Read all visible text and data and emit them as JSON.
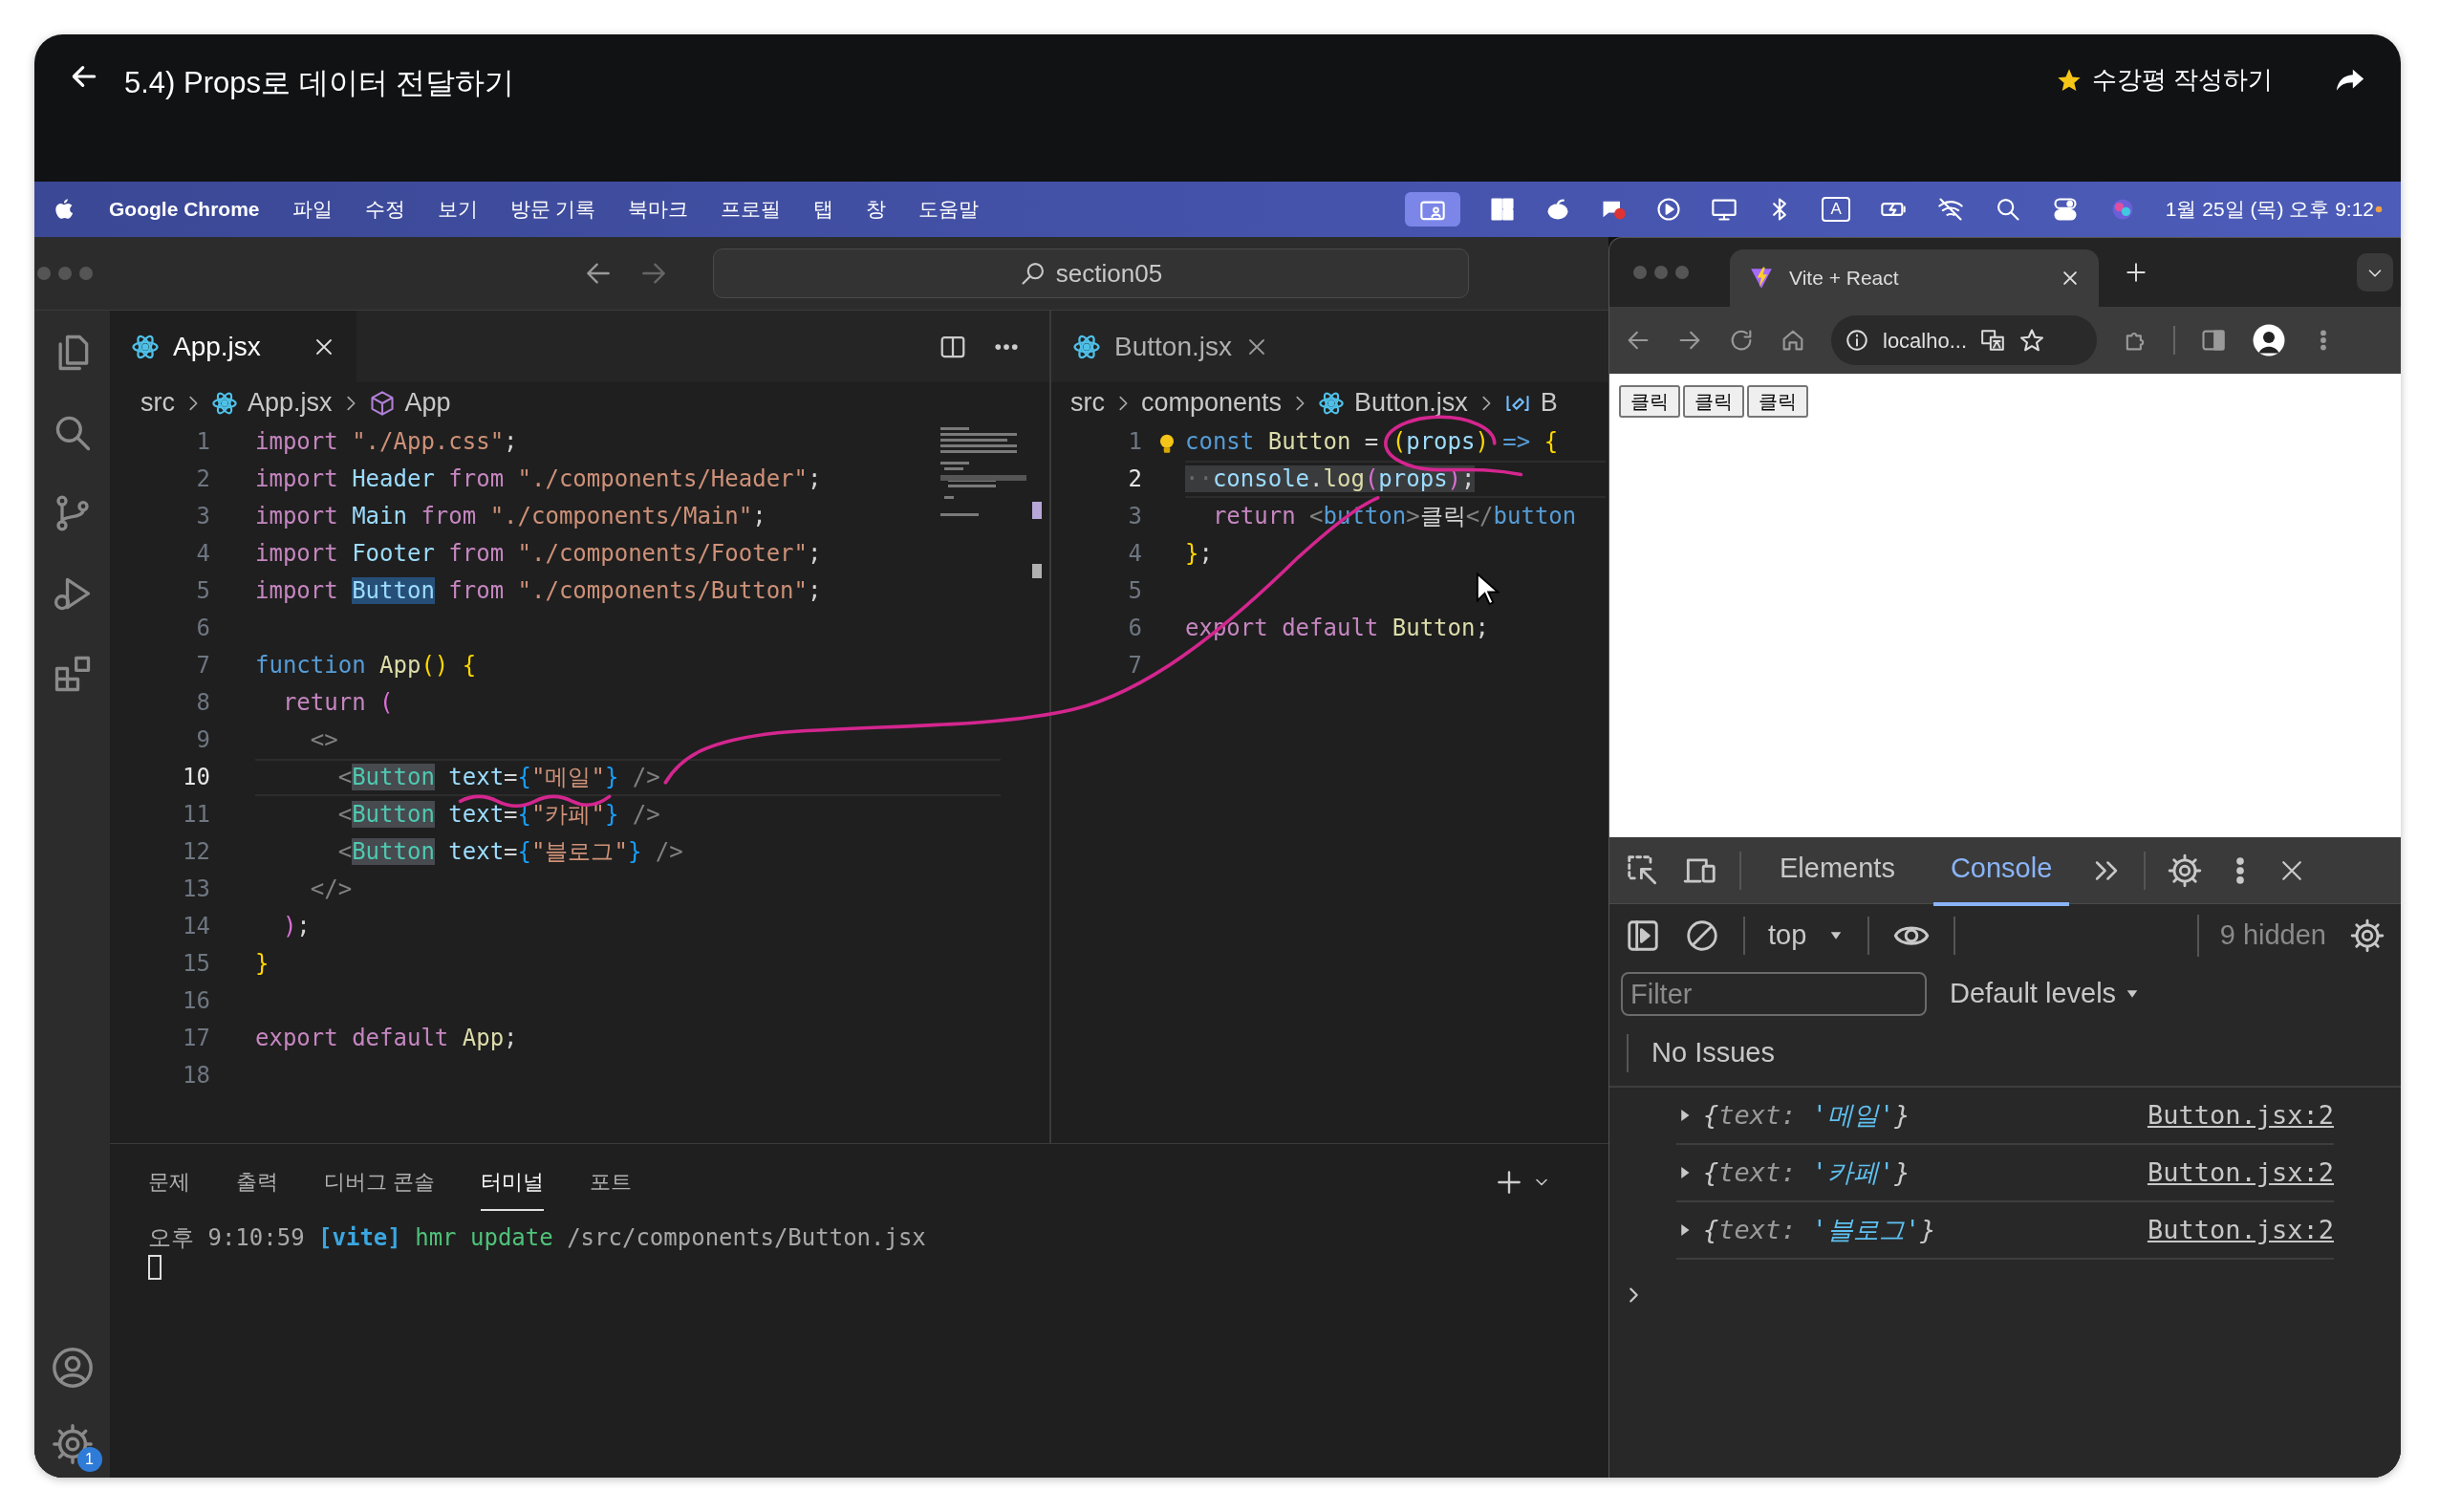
{
  "lecture_bar": {
    "title": "5.4) Props로 데이터 전달하기",
    "review_label": "수강평 작성하기"
  },
  "menu_bar": {
    "app": "Google Chrome",
    "menus": [
      "파일",
      "수정",
      "보기",
      "방문 기록",
      "북마크",
      "프로필",
      "탭",
      "창",
      "도움말"
    ],
    "input_source": "A",
    "clock": "1월 25일 (목) 오후 9:12"
  },
  "activity_bar": {
    "settings_badge": "1"
  },
  "editor": {
    "search": "section05",
    "groups": [
      {
        "tab": "App.jsx",
        "breadcrumb": [
          {
            "kind": "folder",
            "text": "src"
          },
          {
            "kind": "file",
            "text": "App.jsx"
          },
          {
            "kind": "symbol",
            "text": "App"
          }
        ],
        "lines": [
          {
            "number": "1",
            "active": false,
            "tokens": [
              {
                "kind": "kw",
                "text": "import "
              },
              {
                "kind": "str",
                "text": "\"./App.css\""
              },
              {
                "kind": "p",
                "text": ";"
              }
            ]
          },
          {
            "number": "2",
            "active": false,
            "tokens": [
              {
                "kind": "kw",
                "text": "import "
              },
              {
                "kind": "var",
                "text": "Header"
              },
              {
                "kind": "kw",
                "text": " from "
              },
              {
                "kind": "str",
                "text": "\"./components/Header\""
              },
              {
                "kind": "p",
                "text": ";"
              }
            ]
          },
          {
            "number": "3",
            "active": false,
            "tokens": [
              {
                "kind": "kw",
                "text": "import "
              },
              {
                "kind": "var",
                "text": "Main"
              },
              {
                "kind": "kw",
                "text": " from "
              },
              {
                "kind": "str",
                "text": "\"./components/Main\""
              },
              {
                "kind": "p",
                "text": ";"
              }
            ]
          },
          {
            "number": "4",
            "active": false,
            "tokens": [
              {
                "kind": "kw",
                "text": "import "
              },
              {
                "kind": "var",
                "text": "Footer"
              },
              {
                "kind": "kw",
                "text": " from "
              },
              {
                "kind": "str",
                "text": "\"./components/Footer\""
              },
              {
                "kind": "p",
                "text": ";"
              }
            ]
          },
          {
            "number": "5",
            "active": false,
            "tokens": [
              {
                "kind": "kw",
                "text": "import "
              },
              {
                "kind": "var_selection",
                "text": "Button"
              },
              {
                "kind": "kw",
                "text": " from "
              },
              {
                "kind": "str",
                "text": "\"./components/Button\""
              },
              {
                "kind": "p",
                "text": ";"
              }
            ]
          },
          {
            "number": "6",
            "active": false
          },
          {
            "number": "7",
            "active": false,
            "tokens": [
              {
                "kind": "ctrl",
                "text": "function "
              },
              {
                "kind": "fn",
                "text": "App"
              },
              {
                "kind": "brace",
                "text": "() {"
              }
            ]
          },
          {
            "number": "8",
            "active": false,
            "tokens": [
              {
                "kind": "kw",
                "text": "  return "
              },
              {
                "kind": "paren",
                "text": "("
              }
            ]
          },
          {
            "number": "9",
            "active": false,
            "tokens": [
              {
                "kind": "grey",
                "text": "    <>"
              }
            ]
          },
          {
            "number": "10",
            "active": true,
            "tokens": [
              {
                "kind": "grey",
                "text": "      <"
              },
              {
                "kind": "tag_match",
                "text": "Button"
              },
              {
                "kind": "attr",
                "text": " text"
              },
              {
                "kind": "p",
                "text": "="
              },
              {
                "kind": "jsx",
                "text": "{"
              },
              {
                "kind": "str",
                "text": "\"메일\""
              },
              {
                "kind": "jsx",
                "text": "}"
              },
              {
                "kind": "grey",
                "text": " />"
              }
            ]
          },
          {
            "number": "11",
            "active": false,
            "tokens": [
              {
                "kind": "grey",
                "text": "      <"
              },
              {
                "kind": "tag_match",
                "text": "Button"
              },
              {
                "kind": "attr",
                "text": " text"
              },
              {
                "kind": "p",
                "text": "="
              },
              {
                "kind": "jsx",
                "text": "{"
              },
              {
                "kind": "str",
                "text": "\"카페\""
              },
              {
                "kind": "jsx",
                "text": "}"
              },
              {
                "kind": "grey",
                "text": " />"
              }
            ]
          },
          {
            "number": "12",
            "active": false,
            "tokens": [
              {
                "kind": "grey",
                "text": "      <"
              },
              {
                "kind": "tag_match",
                "text": "Button"
              },
              {
                "kind": "attr",
                "text": " text"
              },
              {
                "kind": "p",
                "text": "="
              },
              {
                "kind": "jsx",
                "text": "{"
              },
              {
                "kind": "str",
                "text": "\"블로그\""
              },
              {
                "kind": "jsx",
                "text": "}"
              },
              {
                "kind": "grey",
                "text": " />"
              }
            ]
          },
          {
            "number": "13",
            "active": false,
            "tokens": [
              {
                "kind": "grey",
                "text": "    </>"
              }
            ]
          },
          {
            "number": "14",
            "active": false,
            "tokens": [
              {
                "kind": "paren",
                "text": "  )"
              },
              {
                "kind": "p",
                "text": ";"
              }
            ]
          },
          {
            "number": "15",
            "active": false,
            "tokens": [
              {
                "kind": "brace",
                "text": "}"
              }
            ]
          },
          {
            "number": "16",
            "active": false
          },
          {
            "number": "17",
            "active": false,
            "tokens": [
              {
                "kind": "kw",
                "text": "export default "
              },
              {
                "kind": "fn",
                "text": "App"
              },
              {
                "kind": "p",
                "text": ";"
              }
            ]
          },
          {
            "number": "18",
            "active": false
          }
        ]
      },
      {
        "tab": "Button.jsx",
        "breadcrumb": [
          {
            "kind": "folder",
            "text": "src"
          },
          {
            "kind": "folder",
            "text": "components"
          },
          {
            "kind": "file",
            "text": "Button.jsx"
          },
          {
            "kind": "variable",
            "text": "B"
          }
        ],
        "lines": [
          {
            "number": "1",
            "active": false,
            "tokens": [
              {
                "kind": "ctrl",
                "text": "const "
              },
              {
                "kind": "fn",
                "text": "Button"
              },
              {
                "kind": "p",
                "text": " = "
              },
              {
                "kind": "brace",
                "text": "("
              },
              {
                "kind": "var",
                "text": "props"
              },
              {
                "kind": "brace",
                "text": ")"
              },
              {
                "kind": "ctrl",
                "text": " => "
              },
              {
                "kind": "brace",
                "text": "{"
              }
            ]
          },
          {
            "number": "2",
            "active": true,
            "tokens": [
              {
                "kind": "ws_line",
                "text": "··"
              },
              {
                "kind": "var_line",
                "text": "console"
              },
              {
                "kind": "p_line",
                "text": "."
              },
              {
                "kind": "fn_line",
                "text": "log"
              },
              {
                "kind": "paren_line",
                "text": "("
              },
              {
                "kind": "var_line",
                "text": "props"
              },
              {
                "kind": "paren_line",
                "text": ")"
              },
              {
                "kind": "p_line",
                "text": ";"
              }
            ]
          },
          {
            "number": "3",
            "active": false,
            "tokens": [
              {
                "kind": "kw",
                "text": "  return "
              },
              {
                "kind": "grey",
                "text": "<"
              },
              {
                "kind": "ctrl",
                "text": "button"
              },
              {
                "kind": "grey",
                "text": ">"
              },
              {
                "kind": "p",
                "text": "클릭"
              },
              {
                "kind": "grey",
                "text": "</"
              },
              {
                "kind": "ctrl",
                "text": "button"
              }
            ]
          },
          {
            "number": "4",
            "active": false,
            "tokens": [
              {
                "kind": "brace",
                "text": "}"
              },
              {
                "kind": "p",
                "text": ";"
              }
            ]
          },
          {
            "number": "5",
            "active": false
          },
          {
            "number": "6",
            "active": false,
            "tokens": [
              {
                "kind": "kw",
                "text": "export default "
              },
              {
                "kind": "fn",
                "text": "Button"
              },
              {
                "kind": "p",
                "text": ";"
              }
            ]
          },
          {
            "number": "7",
            "active": false
          }
        ]
      }
    ]
  },
  "panel": {
    "tabs": [
      {
        "label": "문제",
        "selected": false
      },
      {
        "label": "출력",
        "selected": false
      },
      {
        "label": "디버그 콘솔",
        "selected": false
      },
      {
        "label": "터미널",
        "selected": true
      },
      {
        "label": "포트",
        "selected": false
      }
    ],
    "terminal": [
      {
        "kind": "time",
        "text": "오후 9:10:59 "
      },
      {
        "kind": "label",
        "text": "[vite]"
      },
      {
        "kind": "cmd",
        "text": " hmr update "
      },
      {
        "kind": "path",
        "text": "/src/components/Button.jsx"
      }
    ]
  },
  "browser": {
    "tab_title": "Vite + React",
    "address": "localho...",
    "page_buttons": [
      "클릭",
      "클릭",
      "클릭"
    ],
    "devtools": {
      "tabs": [
        {
          "label": "Elements",
          "selected": false
        },
        {
          "label": "Console",
          "selected": true
        }
      ],
      "context": "top",
      "hidden": "9 hidden",
      "filter_placeholder": "Filter",
      "levels": "Default levels",
      "issues": "No Issues",
      "logs": [
        {
          "open": "{",
          "key": "text:",
          "value": "'메일'",
          "close": "}",
          "source": "Button.jsx:2"
        },
        {
          "open": "{",
          "key": "text:",
          "value": "'카페'",
          "close": "}",
          "source": "Button.jsx:2"
        },
        {
          "open": "{",
          "key": "text:",
          "value": "'블로그'",
          "close": "}",
          "source": "Button.jsx:2"
        }
      ]
    }
  }
}
